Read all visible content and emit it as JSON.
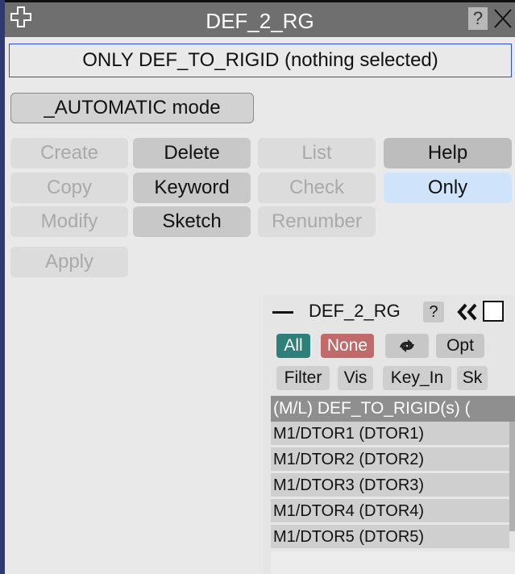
{
  "window": {
    "title": "DEF_2_RG",
    "help_label": "?",
    "colors": {
      "titlebar": "#6f6f6f",
      "frame": "#2f3a73"
    }
  },
  "status": {
    "text": "ONLY DEF_TO_RIGID (nothing selected)"
  },
  "automatic_button": {
    "label": "_AUTOMATIC mode"
  },
  "command_grid": {
    "rows": [
      [
        {
          "label": "Create",
          "state": "disabled"
        },
        {
          "label": "Delete",
          "state": "active"
        },
        {
          "label": "List",
          "state": "disabled"
        },
        {
          "label": "Help",
          "state": "selected"
        }
      ],
      [
        {
          "label": "Copy",
          "state": "disabled"
        },
        {
          "label": "Keyword",
          "state": "active"
        },
        {
          "label": "Check",
          "state": "disabled"
        },
        {
          "label": "Only",
          "state": "highlighted"
        }
      ],
      [
        {
          "label": "Modify",
          "state": "disabled"
        },
        {
          "label": "Sketch",
          "state": "active"
        },
        {
          "label": "Renumber",
          "state": "disabled"
        }
      ],
      [
        {
          "label": "Apply",
          "state": "disabled"
        }
      ]
    ]
  },
  "selection_panel": {
    "title": "DEF_2_RG",
    "help_label": "?",
    "buttons_row1": {
      "all": "All",
      "none": "None",
      "opt": "Opt"
    },
    "buttons_row2": {
      "filter": "Filter",
      "vis": "Vis",
      "key_in": "Key_In",
      "sk": "Sk"
    },
    "list_header": "(M/L) DEF_TO_RIGID(s) (",
    "items": [
      "M1/DTOR1 (DTOR1)",
      "M1/DTOR2 (DTOR2)",
      "M1/DTOR3 (DTOR3)",
      "M1/DTOR4 (DTOR4)",
      "M1/DTOR5 (DTOR5)"
    ],
    "colors": {
      "all": "#2e7e79",
      "none": "#c06a6a"
    }
  }
}
